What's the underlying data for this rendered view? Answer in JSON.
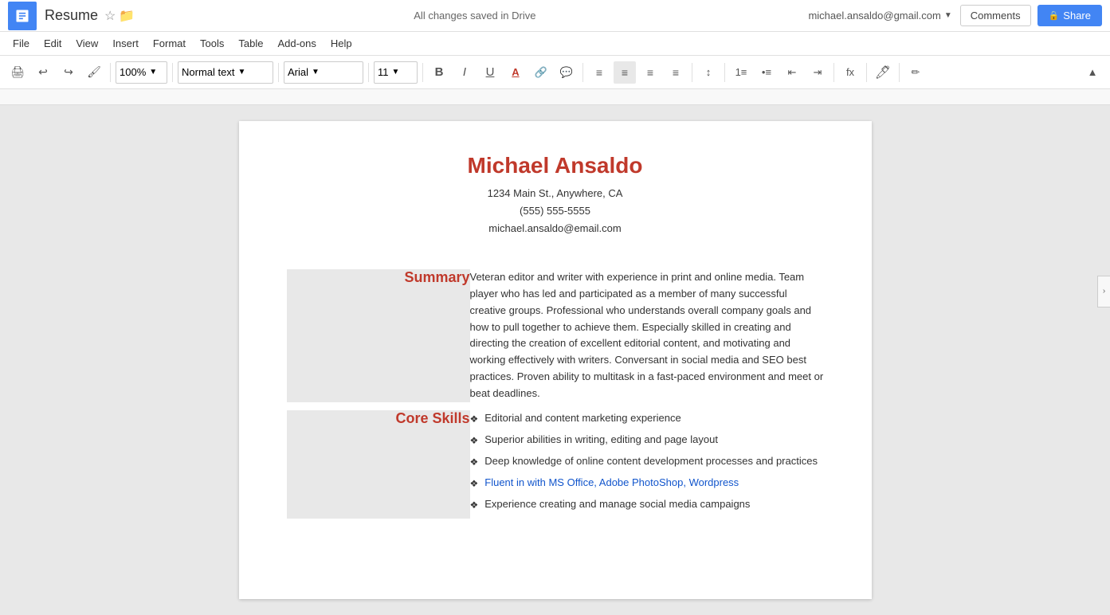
{
  "appIcon": {
    "color": "#4285f4"
  },
  "topBar": {
    "docTitle": "Resume",
    "starLabel": "☆",
    "folderLabel": "📁",
    "autosaveStatus": "All changes saved in Drive",
    "userEmail": "michael.ansaldo@gmail.com",
    "commentsLabel": "Comments",
    "shareLabel": "Share",
    "lockIcon": "🔒"
  },
  "menuBar": {
    "items": [
      "File",
      "Edit",
      "View",
      "Insert",
      "Format",
      "Tools",
      "Table",
      "Add-ons",
      "Help"
    ]
  },
  "toolbar": {
    "zoom": "100%",
    "style": "Normal text",
    "font": "Arial",
    "size": "11",
    "boldLabel": "B",
    "italicLabel": "I",
    "underlineLabel": "U"
  },
  "resume": {
    "name": "Michael Ansaldo",
    "address": "1234 Main St., Anywhere, CA",
    "phone": "(555) 555-5555",
    "email": "michael.ansaldo@email.com",
    "sections": [
      {
        "label": "Summary",
        "content": "Veteran editor and writer with experience in print and online media. Team player who has led and participated as a member of many successful creative groups. Professional who understands overall company goals and how to pull together to achieve them. Especially skilled in creating and directing the creation of excellent editorial content, and motivating and working effectively with writers. Conversant in social media and SEO best practices. Proven ability to multitask in a fast-paced environment and meet or beat deadlines."
      },
      {
        "label": "Core Skills",
        "bullets": [
          {
            "text": "Editorial and content marketing experience",
            "color": "black"
          },
          {
            "text": "Superior abilities in writing, editing and page layout",
            "color": "black"
          },
          {
            "text": "Deep knowledge of online content development processes and practices",
            "color": "black"
          },
          {
            "text": "Fluent in with MS Office, Adobe PhotoShop, Wordpress",
            "color": "blue"
          },
          {
            "text": "Experience creating and manage social media campaigns",
            "color": "black"
          }
        ]
      }
    ]
  }
}
